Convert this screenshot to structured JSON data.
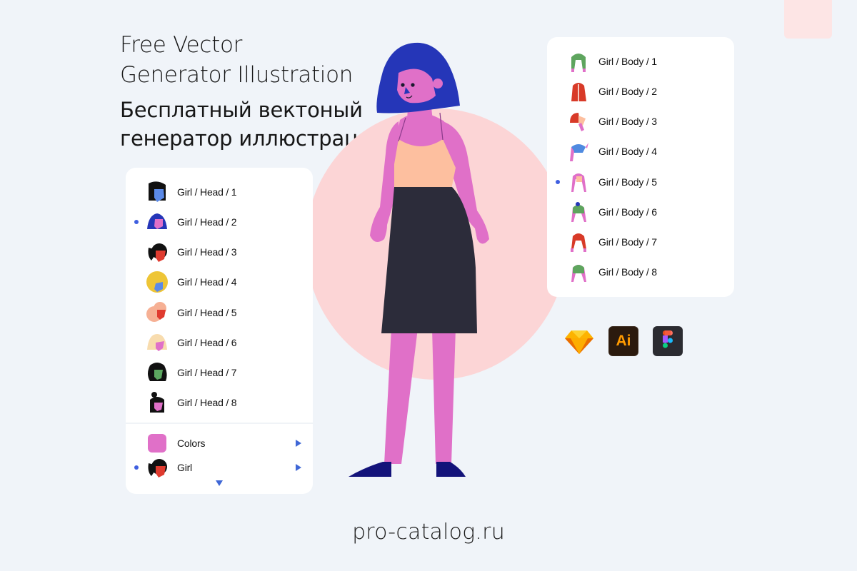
{
  "header": {
    "title_en_line1": "Free Vector",
    "title_en_line2": "Generator Illustration",
    "title_ru_line1": "Бесплатный вектоный",
    "title_ru_line2": "генератор иллюстраций"
  },
  "head_panel": {
    "items": [
      {
        "label": "Girl / Head / 1",
        "icon": "girl-head-1-icon",
        "selected": false
      },
      {
        "label": "Girl / Head / 2",
        "icon": "girl-head-2-icon",
        "selected": true
      },
      {
        "label": "Girl / Head / 3",
        "icon": "girl-head-3-icon",
        "selected": false
      },
      {
        "label": "Girl / Head / 4",
        "icon": "girl-head-4-icon",
        "selected": false
      },
      {
        "label": "Girl / Head / 5",
        "icon": "girl-head-5-icon",
        "selected": false
      },
      {
        "label": "Girl / Head / 6",
        "icon": "girl-head-6-icon",
        "selected": false
      },
      {
        "label": "Girl / Head / 7",
        "icon": "girl-head-7-icon",
        "selected": false
      },
      {
        "label": "Girl / Head / 8",
        "icon": "girl-head-8-icon",
        "selected": false
      }
    ],
    "groups": [
      {
        "label": "Colors",
        "icon": "color-swatch-icon",
        "selected": false,
        "has_submenu": true,
        "swatch_color": "#e070c8"
      },
      {
        "label": "Girl",
        "icon": "girl-head-3-icon",
        "selected": true,
        "has_submenu": true
      }
    ],
    "more_indicator": "chevron-down-icon"
  },
  "body_panel": {
    "items": [
      {
        "label": "Girl / Body / 1",
        "icon": "girl-body-1-icon",
        "selected": false
      },
      {
        "label": "Girl / Body / 2",
        "icon": "girl-body-2-icon",
        "selected": false
      },
      {
        "label": "Girl / Body / 3",
        "icon": "girl-body-3-icon",
        "selected": false
      },
      {
        "label": "Girl / Body / 4",
        "icon": "girl-body-4-icon",
        "selected": false
      },
      {
        "label": "Girl / Body / 5",
        "icon": "girl-body-5-icon",
        "selected": true
      },
      {
        "label": "Girl / Body / 6",
        "icon": "girl-body-6-icon",
        "selected": false
      },
      {
        "label": "Girl / Body / 7",
        "icon": "girl-body-7-icon",
        "selected": false
      },
      {
        "label": "Girl / Body / 8",
        "icon": "girl-body-8-icon",
        "selected": false
      }
    ]
  },
  "tools": [
    {
      "name": "sketch-icon"
    },
    {
      "name": "illustrator-icon",
      "text": "Ai"
    },
    {
      "name": "figma-icon"
    }
  ],
  "footer": {
    "site": "pro-catalog.ru"
  },
  "colors": {
    "background": "#f0f4f9",
    "accent_blue": "#3f5fe0",
    "circle_pink": "#fcd5d6",
    "skin": "#e070c8",
    "hair": "#2536b8",
    "top": "#fdbf9f",
    "skirt": "#2c2c3a",
    "shoes": "#1a1a78"
  }
}
